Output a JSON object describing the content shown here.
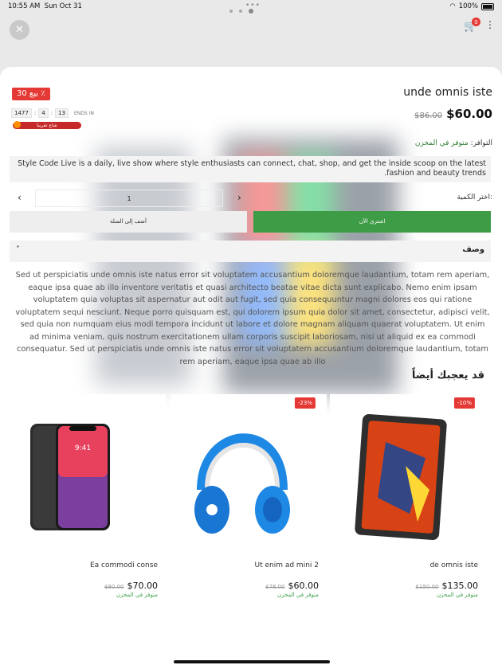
{
  "status": {
    "time": "10:55 AM",
    "date": "Sun Oct 31",
    "battery": "100%"
  },
  "header": {
    "cart_count": "0"
  },
  "product": {
    "sale_badge": "بيع 30 ٪",
    "title": "unde omnis iste",
    "price": "$60.00",
    "old_price": "$86.00",
    "timer": {
      "days": "1477",
      "hours": "4",
      "minutes": "13",
      "ends_label": "ENDS IN"
    },
    "sold_label": "شاع تقريبا",
    "stock_label": "التوافر:",
    "stock_value": "متوفر في المخزن",
    "short_description": "Style Code Live is a daily, live show where style enthusiasts can connect, chat, shop, and get the inside scoop on the latest fashion and beauty trends.",
    "quantity_label": "اختر الكمية:",
    "quantity": "1",
    "add_to_cart": "أضف إلى السلة",
    "buy_now": "اشتري الآن",
    "description_title": "وصف",
    "description": "Sed ut perspiciatis unde omnis iste natus error sit voluptatem accusantium doloremque laudantium, totam rem aperiam, eaque ipsa quae ab illo inventore veritatis et quasi architecto beatae vitae dicta sunt explicabo. Nemo enim ipsam voluptatem quia voluptas sit aspernatur aut odit aut fugit, sed quia consequuntur magni dolores eos qui ratione voluptatem sequi nesciunt. Neque porro quisquam est, qui dolorem ipsum quia dolor sit amet, consectetur, adipisci velit, sed quia non numquam eius modi tempora incidunt ut labore et dolore magnam aliquam quaerat voluptatem. Ut enim ad minima veniam, quis nostrum exercitationem ullam corporis suscipit laboriosam, nisi ut aliquid ex ea commodi consequatur. Sed ut perspiciatis unde omnis iste natus error sit voluptatem accusantium doloremque laudantium, totam rem aperiam, eaque ipsa quae ab illo"
  },
  "related": {
    "title": "قد يعجبك أيضاً",
    "items": [
      {
        "name": "Ea commodi conse",
        "price": "$70.00",
        "old_price": "$80.00",
        "stock": "متوفر في المخزن",
        "discount": "",
        "icon": "phone-image"
      },
      {
        "name": "Ut enim ad mini 2",
        "price": "$60.00",
        "old_price": "$78.00",
        "stock": "متوفر في المخزن",
        "discount": "-23%",
        "icon": "headphones-image"
      },
      {
        "name": "de omnis iste",
        "price": "$135.00",
        "old_price": "$150.00",
        "stock": "متوفر في المخزن",
        "discount": "-10%",
        "icon": "tablet-image"
      }
    ]
  }
}
